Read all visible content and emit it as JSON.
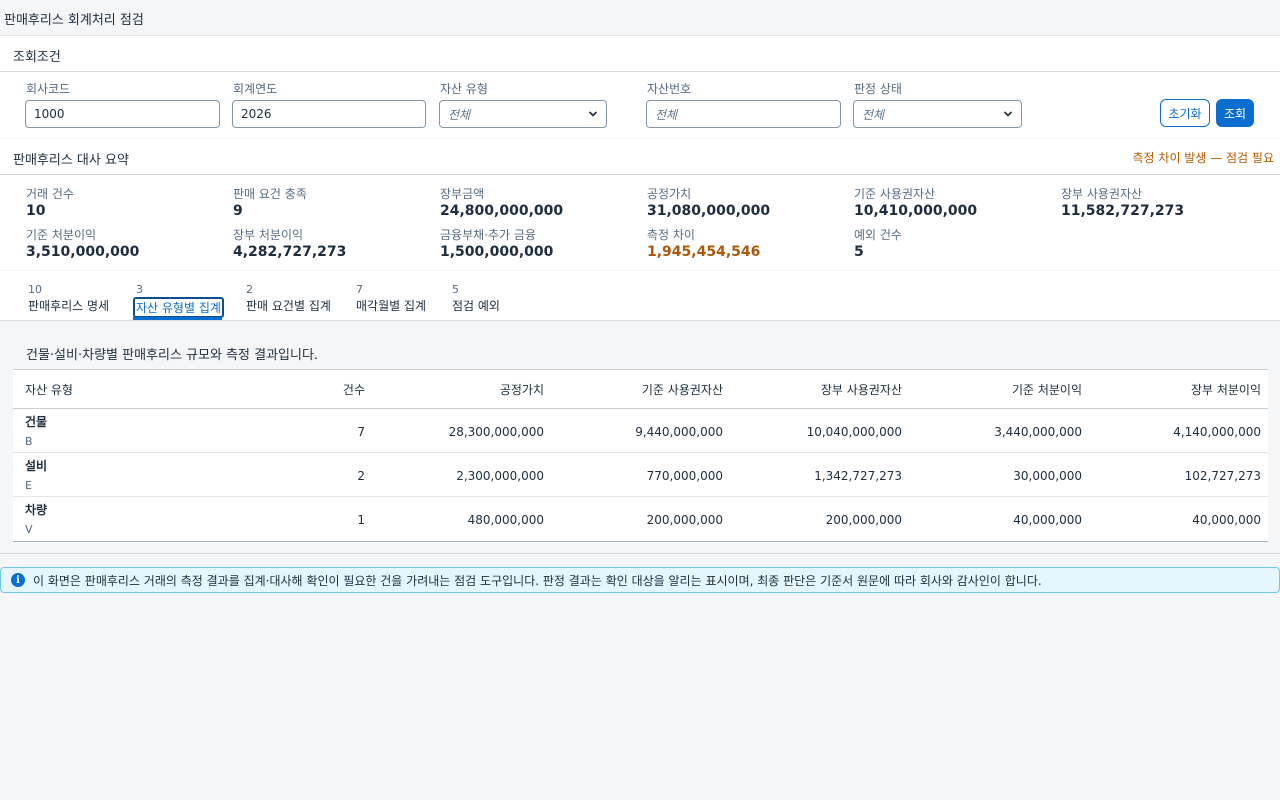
{
  "app": {
    "title": "판매후리스 회계처리 점검"
  },
  "filters": {
    "title": "조회조건",
    "company_code": {
      "label": "회사코드",
      "value": "1000"
    },
    "fiscal_year": {
      "label": "회계연도",
      "value": "2026"
    },
    "asset_type": {
      "label": "자산 유형",
      "value": "전체"
    },
    "asset_number": {
      "label": "자산번호",
      "placeholder": "전체"
    },
    "judgment_status": {
      "label": "판정 상태",
      "value": "전체"
    },
    "reset_label": "초기화",
    "search_label": "조회"
  },
  "summary": {
    "title": "판매후리스 대사 요약",
    "warning": "측정 차이 발생 — 점검 필요",
    "kpis": [
      {
        "label": "거래 건수",
        "value": "10"
      },
      {
        "label": "판매 요건 충족",
        "value": "9"
      },
      {
        "label": "장부금액",
        "value": "24,800,000,000"
      },
      {
        "label": "공정가치",
        "value": "31,080,000,000"
      },
      {
        "label": "기준 사용권자산",
        "value": "10,410,000,000"
      },
      {
        "label": "장부 사용권자산",
        "value": "11,582,727,273"
      },
      {
        "label": "기준 처분이익",
        "value": "3,510,000,000"
      },
      {
        "label": "장부 처분이익",
        "value": "4,282,727,273"
      },
      {
        "label": "금융부채·추가 금융",
        "value": "1,500,000,000"
      },
      {
        "label": "측정 차이",
        "value": "1,945,454,546"
      },
      {
        "label": "예외 건수",
        "value": "5"
      }
    ]
  },
  "tabs": [
    {
      "count": "10",
      "label": "판매후리스 명세"
    },
    {
      "count": "3",
      "label": "자산 유형별 집계"
    },
    {
      "count": "2",
      "label": "판매 요건별 집계"
    },
    {
      "count": "7",
      "label": "매각월별 집계"
    },
    {
      "count": "5",
      "label": "점검 예외"
    }
  ],
  "content": {
    "description": "건물·설비·차량별 판매후리스 규모와 측정 결과입니다.",
    "columns": [
      "자산 유형",
      "건수",
      "공정가치",
      "기준 사용권자산",
      "장부 사용권자산",
      "기준 처분이익",
      "장부 처분이익"
    ],
    "rows": [
      {
        "name": "건물",
        "code": "B",
        "count": "7",
        "fair_value": "28,300,000,000",
        "base_rou": "9,440,000,000",
        "book_rou": "10,040,000,000",
        "base_gain": "3,440,000,000",
        "book_gain": "4,140,000,000"
      },
      {
        "name": "설비",
        "code": "E",
        "count": "2",
        "fair_value": "2,300,000,000",
        "base_rou": "770,000,000",
        "book_rou": "1,342,727,273",
        "base_gain": "30,000,000",
        "book_gain": "102,727,273"
      },
      {
        "name": "차량",
        "code": "V",
        "count": "1",
        "fair_value": "480,000,000",
        "base_rou": "200,000,000",
        "book_rou": "200,000,000",
        "base_gain": "40,000,000",
        "book_gain": "40,000,000"
      }
    ]
  },
  "info": {
    "icon": "info-icon",
    "text": "이 화면은 판매후리스 거래의 측정 결과를 집계·대사해 확인이 필요한 건을 가려내는 점검 도구입니다. 판정 결과는 확인 대상을 알리는 표시이며, 최종 판단은 기준서 원문에 따라 회사와 감사인이 합니다."
  },
  "colors": {
    "accent": "#0a6ed1",
    "warning": "#b85b00",
    "info_bg": "#e5f6fd"
  }
}
